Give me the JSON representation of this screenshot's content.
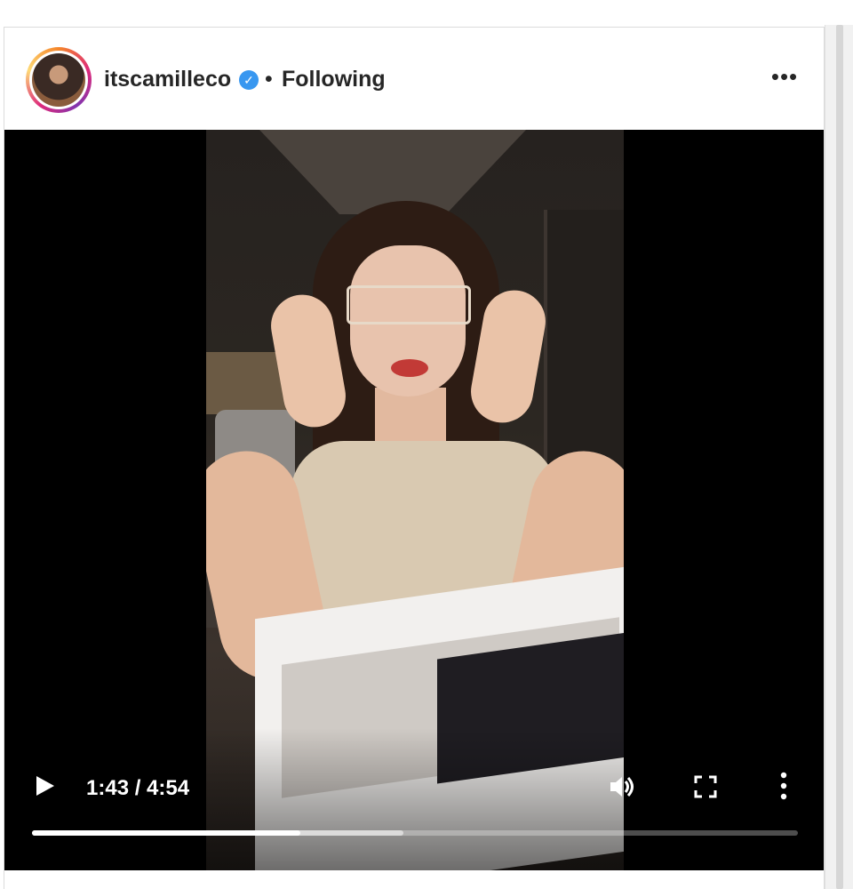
{
  "post": {
    "username": "itscamilleco",
    "separator": "•",
    "follow_status": "Following",
    "verified_glyph": "✓",
    "more_glyph": "•••"
  },
  "video": {
    "time_display": "1:43 / 4:54",
    "progress_fraction": 0.35,
    "buffered_fraction": 0.485,
    "playing": false
  },
  "icons": {
    "more": "more-options-icon",
    "verified": "verified-badge-icon",
    "play": "play-icon",
    "volume": "volume-icon",
    "fullscreen": "fullscreen-icon",
    "menu": "vertical-dots-menu-icon"
  },
  "colors": {
    "verified": "#3897f0",
    "text": "#262626",
    "video_bg": "#000000"
  }
}
